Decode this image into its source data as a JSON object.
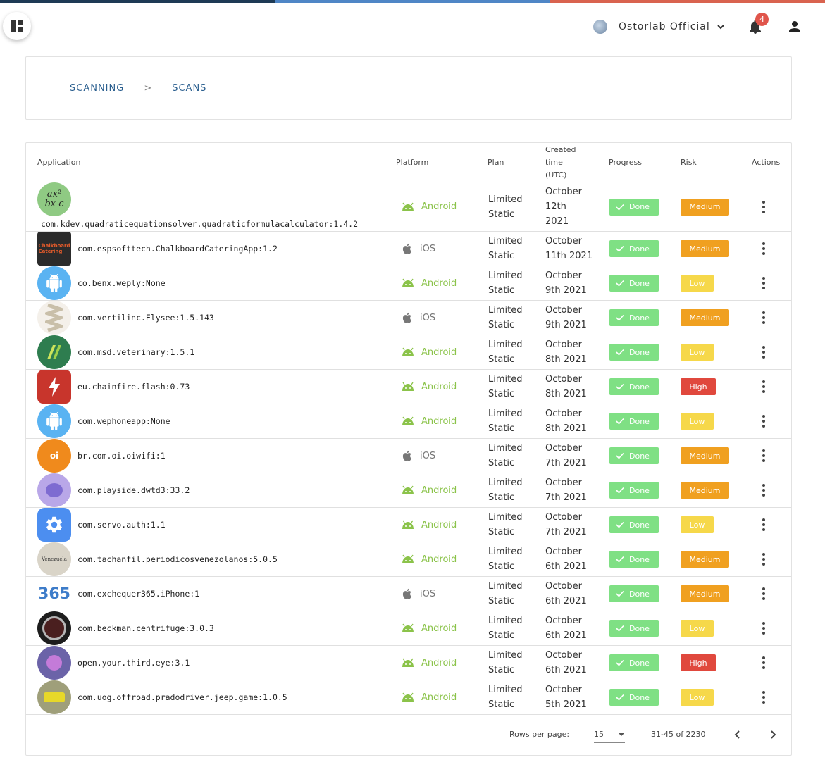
{
  "colors": {
    "strip": [
      "#1e3a55",
      "#4f86c6",
      "#d9634f"
    ],
    "android": "#8bc34a",
    "ios": "#777777",
    "done": "#7fe084",
    "medium": "#f0a020",
    "low": "#f6d84a",
    "high": "#e0483d"
  },
  "header": {
    "org_name": "Ostorlab Official",
    "notifications_count": "4",
    "menu_icon": "dashboard-icon",
    "bell_icon": "bell-icon",
    "user_icon": "person-icon"
  },
  "breadcrumb": {
    "items": [
      "Scanning",
      "Scans"
    ],
    "separator": ">"
  },
  "table": {
    "headers": {
      "application": "Application",
      "platform": "Platform",
      "plan": "Plan",
      "created_1": "Created",
      "created_2": "time",
      "created_3": "(UTC)",
      "progress": "Progress",
      "risk": "Risk",
      "actions": "Actions"
    },
    "rows": [
      {
        "app": "com.kdev.quadraticequationsolver.quadraticformulacalculator:1.4.2",
        "icon": "quadratic-formula-icon",
        "platform": "Android",
        "plan_1": "Limited",
        "plan_2": "Static",
        "created_1": "October",
        "created_2": "12th",
        "created_3": "2021",
        "progress": "Done",
        "risk": "Medium"
      },
      {
        "app": "com.espsofttech.ChalkboardCateringApp:1.2",
        "icon": "chalkboard-catering-icon",
        "platform": "iOS",
        "plan_1": "Limited",
        "plan_2": "Static",
        "created_1": "October",
        "created_2": "11th 2021",
        "progress": "Done",
        "risk": "Medium"
      },
      {
        "app": "co.benx.weply:None",
        "icon": "android-default-icon",
        "platform": "Android",
        "plan_1": "Limited",
        "plan_2": "Static",
        "created_1": "October",
        "created_2": "9th 2021",
        "progress": "Done",
        "risk": "Low"
      },
      {
        "app": "com.vertilinc.Elysee:1.5.143",
        "icon": "elysee-icon",
        "platform": "iOS",
        "plan_1": "Limited",
        "plan_2": "Static",
        "created_1": "October",
        "created_2": "9th 2021",
        "progress": "Done",
        "risk": "Medium"
      },
      {
        "app": "com.msd.veterinary:1.5.1",
        "icon": "msd-veterinary-icon",
        "platform": "Android",
        "plan_1": "Limited",
        "plan_2": "Static",
        "created_1": "October",
        "created_2": "8th 2021",
        "progress": "Done",
        "risk": "Low"
      },
      {
        "app": "eu.chainfire.flash:0.73",
        "icon": "flash-icon",
        "platform": "Android",
        "plan_1": "Limited",
        "plan_2": "Static",
        "created_1": "October",
        "created_2": "8th 2021",
        "progress": "Done",
        "risk": "High"
      },
      {
        "app": "com.wephoneapp:None",
        "icon": "android-default-icon",
        "platform": "Android",
        "plan_1": "Limited",
        "plan_2": "Static",
        "created_1": "October",
        "created_2": "8th 2021",
        "progress": "Done",
        "risk": "Low"
      },
      {
        "app": "br.com.oi.oiwifi:1",
        "icon": "oi-wifi-icon",
        "platform": "iOS",
        "plan_1": "Limited",
        "plan_2": "Static",
        "created_1": "October",
        "created_2": "7th 2021",
        "progress": "Done",
        "risk": "Medium"
      },
      {
        "app": "com.playside.dwtd3:33.2",
        "icon": "dwtd-game-icon",
        "platform": "Android",
        "plan_1": "Limited",
        "plan_2": "Static",
        "created_1": "October",
        "created_2": "7th 2021",
        "progress": "Done",
        "risk": "Medium"
      },
      {
        "app": "com.servo.auth:1.1",
        "icon": "gear-app-icon",
        "platform": "Android",
        "plan_1": "Limited",
        "plan_2": "Static",
        "created_1": "October",
        "created_2": "7th 2021",
        "progress": "Done",
        "risk": "Low"
      },
      {
        "app": "com.tachanfil.periodicosvenezolanos:5.0.5",
        "icon": "newspaper-icon",
        "platform": "Android",
        "plan_1": "Limited",
        "plan_2": "Static",
        "created_1": "October",
        "created_2": "6th 2021",
        "progress": "Done",
        "risk": "Medium"
      },
      {
        "app": "com.exchequer365.iPhone:1",
        "icon": "exchequer-365-icon",
        "platform": "iOS",
        "plan_1": "Limited",
        "plan_2": "Static",
        "created_1": "October",
        "created_2": "6th 2021",
        "progress": "Done",
        "risk": "Medium"
      },
      {
        "app": "com.beckman.centrifuge:3.0.3",
        "icon": "centrifuge-icon",
        "platform": "Android",
        "plan_1": "Limited",
        "plan_2": "Static",
        "created_1": "October",
        "created_2": "6th 2021",
        "progress": "Done",
        "risk": "Low"
      },
      {
        "app": "open.your.third.eye:3.1",
        "icon": "third-eye-icon",
        "platform": "Android",
        "plan_1": "Limited",
        "plan_2": "Static",
        "created_1": "October",
        "created_2": "6th 2021",
        "progress": "Done",
        "risk": "High"
      },
      {
        "app": "com.uog.offroad.pradodriver.jeep.game:1.0.5",
        "icon": "jeep-game-icon",
        "platform": "Android",
        "plan_1": "Limited",
        "plan_2": "Static",
        "created_1": "October",
        "created_2": "5th 2021",
        "progress": "Done",
        "risk": "Low"
      }
    ]
  },
  "pagination": {
    "rows_per_page_label": "Rows per page:",
    "rows_per_page": "15",
    "range": "31-45 of 2230"
  }
}
